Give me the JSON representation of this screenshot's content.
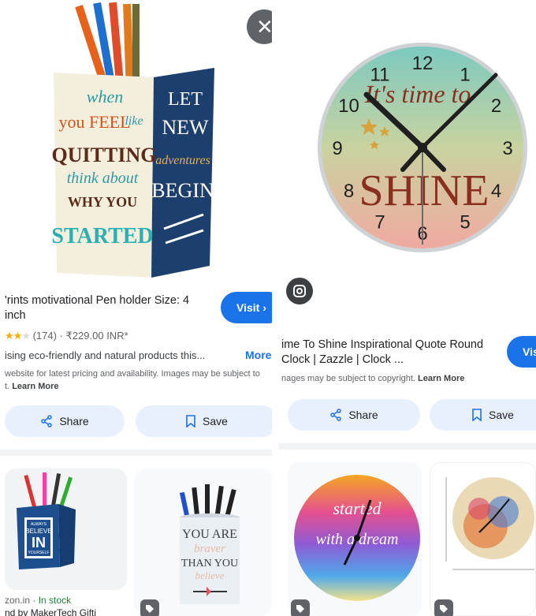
{
  "left": {
    "title_line1": "'rints motivational Pen holder Size: 4",
    "title_line2": "inch",
    "visit_label": "Visit",
    "rating_count": "(174)",
    "separator": "·",
    "price": "₹229.00 INR*",
    "description": "ising eco-friendly and natural products this...",
    "more_label": "More",
    "copyright_line1": " website for latest pricing and availability. Images may be subject to",
    "copyright_line2_prefix": "t.",
    "learn_more": "Learn More",
    "share_label": "Share",
    "save_label": "Save",
    "hero_text": {
      "face1": [
        "when",
        "you FEEL",
        "like",
        "QUITTING",
        "think about",
        "WHY YOU",
        "STARTED"
      ],
      "face2": [
        "LET",
        "NEW",
        "adventures",
        "BEGIN"
      ]
    },
    "related": [
      {
        "source": "zon.in",
        "status": "In stock",
        "subtitle": "nd by MakerTech Gifti",
        "art": [
          "ALWAYS",
          "BELIEVE",
          "IN",
          "YOURSELF"
        ]
      },
      {
        "art": [
          "YOU ARE",
          "braver",
          "THAN YOU",
          "believe"
        ]
      }
    ]
  },
  "right": {
    "title_line1": "ime To Shine Inspirational Quote Round",
    "title_line2": "Clock | Zazzle | Clock ...",
    "visit_label": "Visi",
    "copyright_text": "nages may be subject to copyright.",
    "learn_more": "Learn More",
    "share_label": "Share",
    "save_label": "Save",
    "clock_text": {
      "top": "It's time to",
      "main": "SHINE"
    },
    "clock_numbers": [
      "12",
      "1",
      "2",
      "3",
      "4",
      "5",
      "6",
      "7",
      "8",
      "9",
      "10",
      "11"
    ],
    "related_clock_text": [
      "started",
      "with a dream"
    ]
  },
  "colors": {
    "accent": "#1a73e8",
    "pill_bg": "#e8f0fe",
    "star": "#f9ab00",
    "in_stock": "#188038"
  },
  "rating": {
    "value": 2.5,
    "max": 5
  }
}
